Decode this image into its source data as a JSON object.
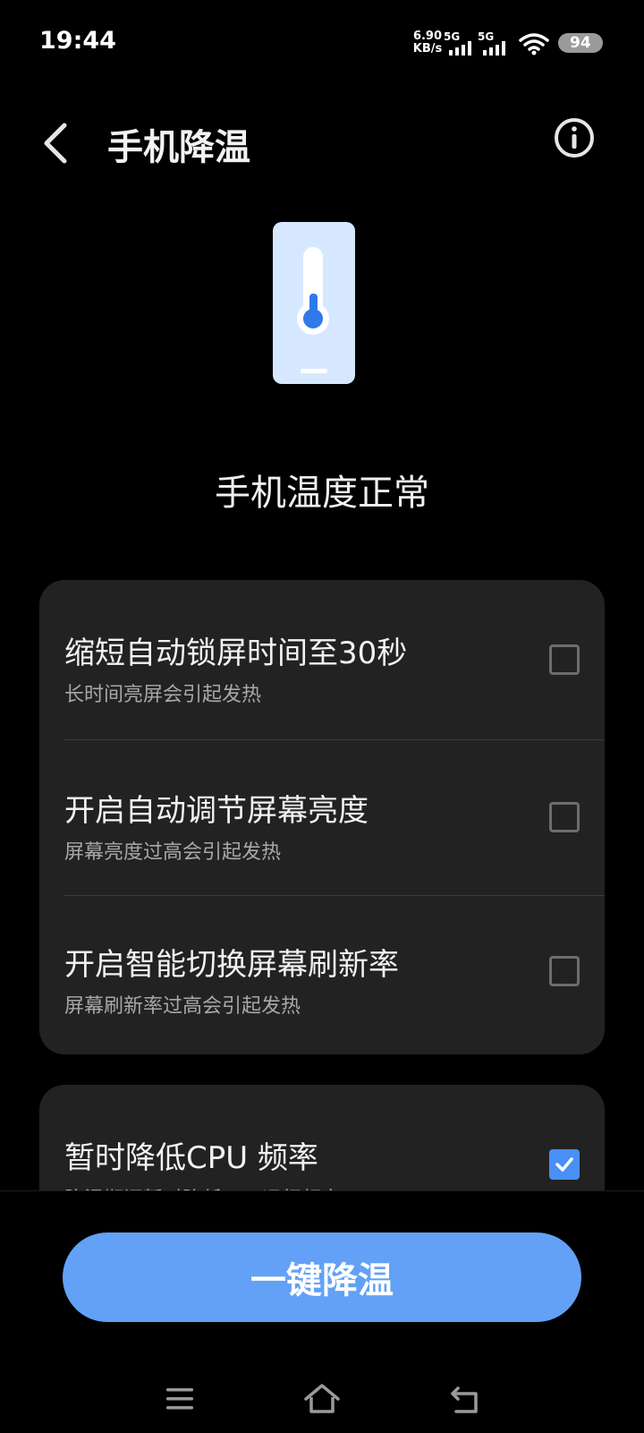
{
  "status_bar": {
    "time": "19:44",
    "net_speed_value": "6.90",
    "net_speed_unit": "KB/s",
    "sim1_label": "5G",
    "sim2_label": "5G",
    "battery": "94"
  },
  "header": {
    "title": "手机降温"
  },
  "hero": {
    "status_text": "手机温度正常",
    "accent_color": "#4a8ff5"
  },
  "options": [
    {
      "title": "缩短自动锁屏时间至30秒",
      "desc": "长时间亮屏会引起发热",
      "checked": false
    },
    {
      "title": "开启自动调节屏幕亮度",
      "desc": "屏幕亮度过高会引起发热",
      "checked": false
    },
    {
      "title": "开启智能切换屏幕刷新率",
      "desc": "屏幕刷新率过高会引起发热",
      "checked": false
    },
    {
      "title": "暂时降低CPU 频率",
      "desc": "降温期间暂时降低CPU运行频率",
      "checked": true
    }
  ],
  "action": {
    "button_label": "一键降温",
    "button_color": "#62a1f6"
  },
  "icons": [
    "back-arrow-icon",
    "info-icon",
    "thermometer-phone-icon",
    "checkbox-icon",
    "menu-icon",
    "home-icon",
    "back-nav-icon"
  ]
}
